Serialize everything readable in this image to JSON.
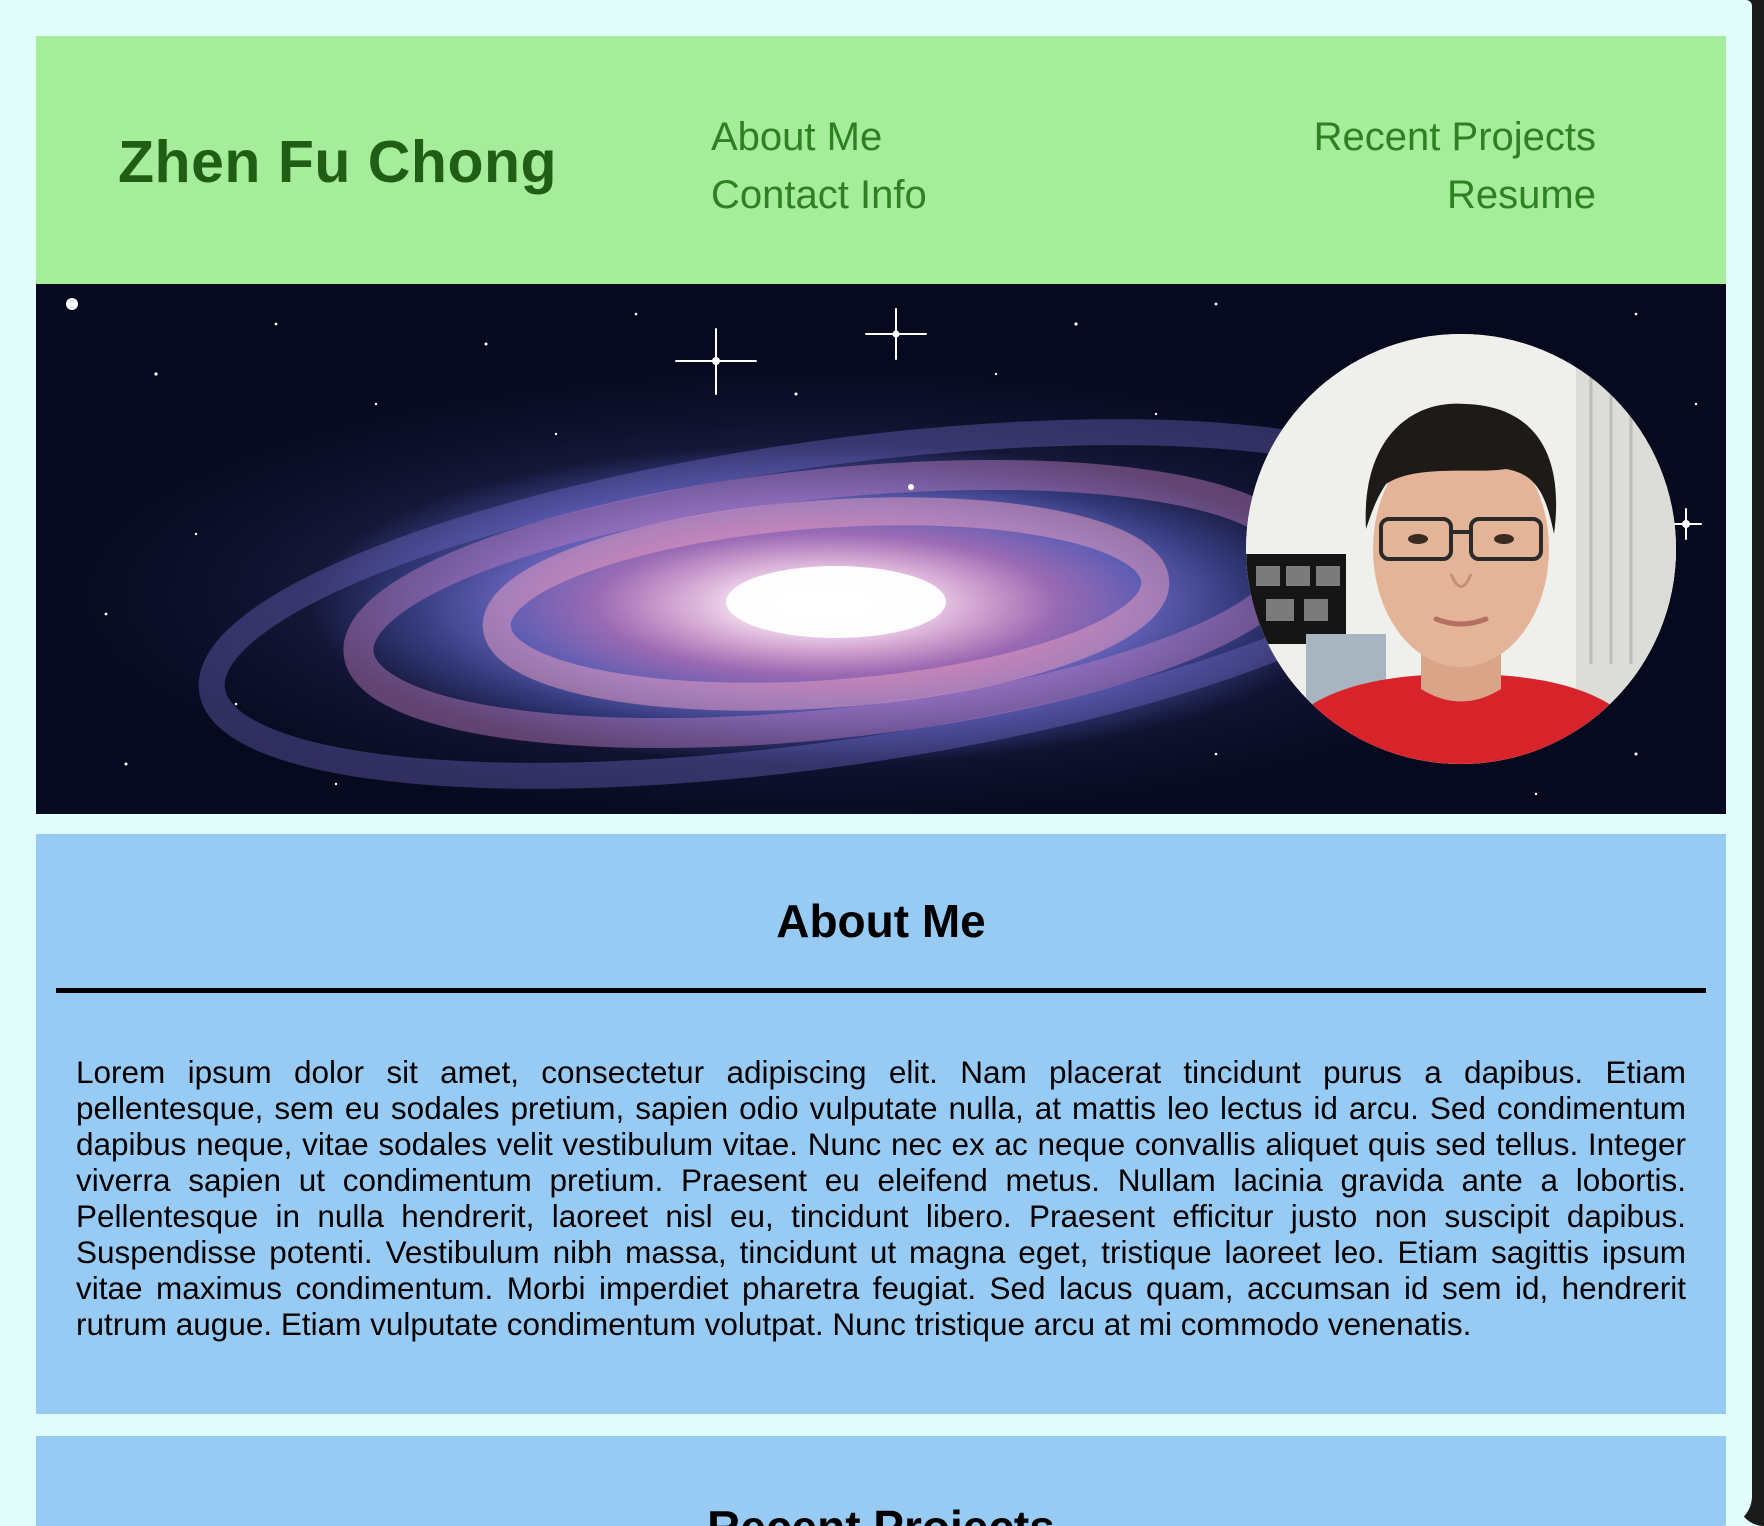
{
  "header": {
    "site_name": "Zhen Fu Chong",
    "nav": {
      "about": "About Me",
      "contact": "Contact Info",
      "projects": "Recent Projects",
      "resume": "Resume"
    }
  },
  "about": {
    "title": "About Me",
    "text": "Lorem ipsum dolor sit amet, consectetur adipiscing elit. Nam placerat tincidunt purus a dapibus. Etiam pellentesque, sem eu sodales pretium, sapien odio vulputate nulla, at mattis leo lectus id arcu. Sed condimentum dapibus neque, vitae sodales velit vestibulum vitae. Nunc nec ex ac neque convallis aliquet quis sed tellus. Integer viverra sapien ut condimentum pretium. Praesent eu eleifend metus. Nullam lacinia gravida ante a lobortis. Pellentesque in nulla hendrerit, laoreet nisl eu, tincidunt libero. Praesent efficitur justo non suscipit dapibus. Suspendisse potenti. Vestibulum nibh massa, tincidunt ut magna eget, tristique laoreet leo. Etiam sagittis ipsum vitae maximus condimentum. Morbi imperdiet pharetra feugiat. Sed lacus quam, accumsan id sem id, hendrerit rutrum augue. Etiam vulputate condimentum volutpat. Nunc tristique arcu at mi commodo venenatis."
  },
  "projects": {
    "title": "Recent Projects"
  },
  "colors": {
    "page_bg": "#e3fdfd",
    "header_bg": "#a6ed9b",
    "site_name": "#215e15",
    "nav_link": "#2e8023",
    "section_bg": "#98cbf4"
  },
  "images": {
    "banner": "spiral-galaxy-banner",
    "avatar": "profile-photo"
  }
}
